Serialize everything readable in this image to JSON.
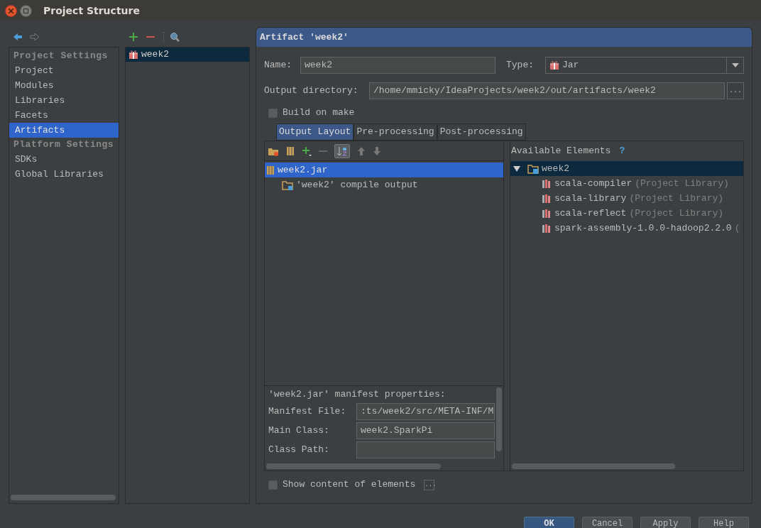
{
  "window": {
    "title": "Project Structure"
  },
  "sidebar": {
    "sections": [
      {
        "heading": "Project Settings",
        "items": [
          {
            "label": "Project",
            "selected": false
          },
          {
            "label": "Modules",
            "selected": false
          },
          {
            "label": "Libraries",
            "selected": false
          },
          {
            "label": "Facets",
            "selected": false
          },
          {
            "label": "Artifacts",
            "selected": true
          }
        ]
      },
      {
        "heading": "Platform Settings",
        "items": [
          {
            "label": "SDKs",
            "selected": false
          },
          {
            "label": "Global Libraries",
            "selected": false
          }
        ]
      }
    ]
  },
  "artifacts_list": {
    "items": [
      {
        "label": "week2",
        "selected": true
      }
    ]
  },
  "artifact_panel": {
    "title": "Artifact 'week2'",
    "name": {
      "label": "Name:",
      "value": "week2"
    },
    "type": {
      "label": "Type:",
      "value": "Jar"
    },
    "output_directory": {
      "label": "Output directory:",
      "value": "/home/mmicky/IdeaProjects/week2/out/artifacts/week2",
      "browse": "..."
    },
    "build_on_make": {
      "label": "Build on make",
      "checked": false
    },
    "tabs": [
      {
        "label": "Output Layout",
        "selected": true
      },
      {
        "label": "Pre-processing",
        "selected": false
      },
      {
        "label": "Post-processing",
        "selected": false
      }
    ],
    "layout_tree": [
      {
        "label": "week2.jar",
        "kind": "jar",
        "selected": true,
        "children": [
          {
            "label": "'week2' compile output",
            "kind": "folder",
            "selected": false
          }
        ]
      }
    ],
    "available_elements": {
      "title": "Available Elements",
      "help": "?",
      "tree": [
        {
          "label": "week2",
          "kind": "module",
          "selected": true,
          "expanded": true,
          "children": [
            {
              "label": "scala-compiler",
              "note": "(Project Library)",
              "kind": "library",
              "selected": false
            },
            {
              "label": "scala-library",
              "note": "(Project Library)",
              "kind": "library",
              "selected": false
            },
            {
              "label": "scala-reflect",
              "note": "(Project Library)",
              "kind": "library",
              "selected": false
            },
            {
              "label": "spark-assembly-1.0.0-hadoop2.2.0",
              "note": "(",
              "kind": "library",
              "selected": false
            }
          ]
        }
      ]
    },
    "manifest": {
      "title": "'week2.jar' manifest properties:",
      "fields": [
        {
          "label": "Manifest File:",
          "value": ":ts/week2/src/META-INF/M"
        },
        {
          "label": "Main Class:",
          "value": "week2.SparkPi"
        },
        {
          "label": "Class Path:"
        }
      ]
    },
    "show_content": {
      "label": "Show content of elements",
      "checked": false,
      "more": "..."
    }
  },
  "buttons": [
    {
      "label": "OK",
      "default": true
    },
    {
      "label": "Cancel",
      "default": false
    },
    {
      "label": "Apply",
      "default": false
    },
    {
      "label": "Help",
      "default": false
    }
  ]
}
